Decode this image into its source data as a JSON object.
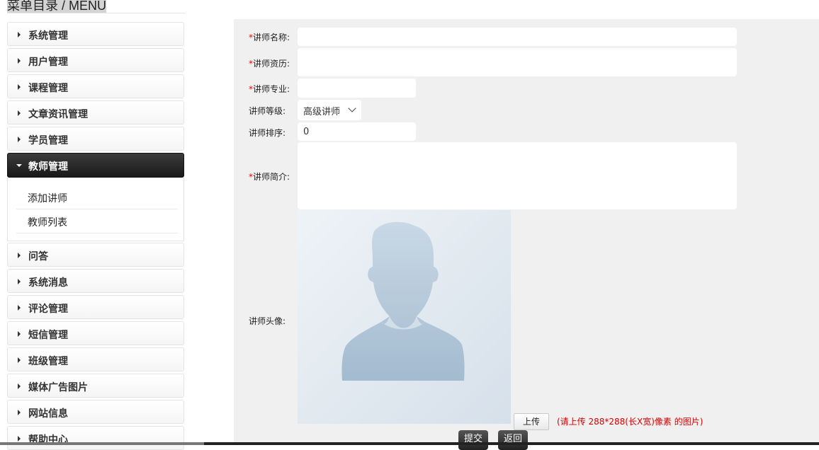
{
  "sidebar": {
    "title": "菜单目录 / MENU",
    "items": [
      {
        "label": "系统管理"
      },
      {
        "label": "用户管理"
      },
      {
        "label": "课程管理"
      },
      {
        "label": "文章资讯管理"
      },
      {
        "label": "学员管理"
      },
      {
        "label": "教师管理",
        "expanded": true
      },
      {
        "label": "问答"
      },
      {
        "label": "系统消息"
      },
      {
        "label": "评论管理"
      },
      {
        "label": "短信管理"
      },
      {
        "label": "班级管理"
      },
      {
        "label": "媒体广告图片"
      },
      {
        "label": "网站信息"
      },
      {
        "label": "帮助中心"
      }
    ],
    "submenu": [
      {
        "label": "添加讲师"
      },
      {
        "label": "教师列表"
      }
    ]
  },
  "form": {
    "name_label": "讲师名称:",
    "name_value": "",
    "career_label": "讲师资历:",
    "career_value": "",
    "major_label": "讲师专业:",
    "major_value": "",
    "level_label": "讲师等级:",
    "level_value": "高级讲师",
    "sort_label": "讲师排序:",
    "sort_value": "0",
    "intro_label": "讲师简介:",
    "intro_value": "",
    "avatar_label": "讲师头像:",
    "required_mark": "*",
    "upload_label": "上传",
    "upload_hint": "(请上传 288*288(长X宽)像素 的图片)",
    "submit_label": "提交",
    "back_label": "返回"
  },
  "colors": {
    "active_menu": "#1f1f1f",
    "required": "#e00000",
    "hint": "#d40000",
    "panel_bg": "#f0f0f0"
  }
}
